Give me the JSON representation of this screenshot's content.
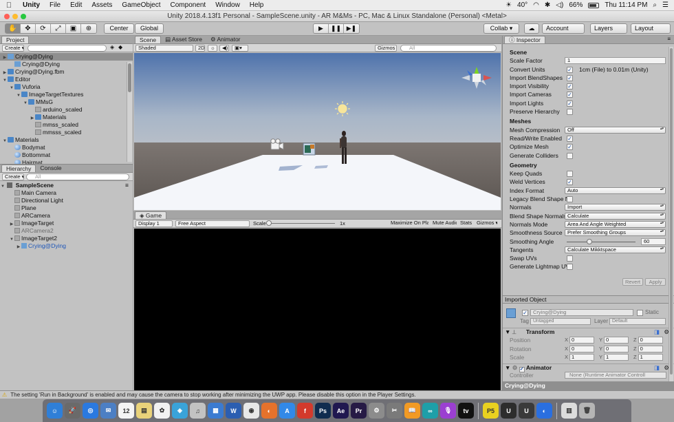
{
  "menubar": {
    "items": [
      "Unity",
      "File",
      "Edit",
      "Assets",
      "GameObject",
      "Component",
      "Window",
      "Help"
    ],
    "weather": "40°",
    "battery": "66%",
    "battery_fill": 0.66,
    "clock": "Thu 11:14 PM"
  },
  "window": {
    "title": "Unity 2018.4.13f1 Personal - SampleScene.unity - AR M&Ms - PC, Mac & Linux Standalone (Personal) <Metal>"
  },
  "toolbar": {
    "tools": [
      "✋",
      "✥",
      "⟳",
      "⤢",
      "▣",
      "⊕"
    ],
    "center": "Center",
    "global": "Global",
    "play": [
      "▶",
      "❚❚",
      "▶❚"
    ],
    "collab": "Collab ▾",
    "cloud": "☁",
    "account": "Account",
    "layers": "Layers",
    "layout": "Layout"
  },
  "project": {
    "tab": "Project",
    "create": "Create ▾",
    "items": [
      {
        "label": "Crying@Dying",
        "indent": 0,
        "arrow": "▶",
        "icon": "cube",
        "sel": true
      },
      {
        "label": "Crying@Dying",
        "indent": 1,
        "arrow": "",
        "icon": "cube"
      },
      {
        "label": "Crying@Dying.fbm",
        "indent": 0,
        "arrow": "▶",
        "icon": "fold"
      },
      {
        "label": "Editor",
        "indent": 0,
        "arrow": "▼",
        "icon": "fold"
      },
      {
        "label": "Vuforia",
        "indent": 1,
        "arrow": "▼",
        "icon": "fold"
      },
      {
        "label": "ImageTargetTextures",
        "indent": 2,
        "arrow": "▼",
        "icon": "fold"
      },
      {
        "label": "MMsG",
        "indent": 3,
        "arrow": "▼",
        "icon": "fold"
      },
      {
        "label": "arduino_scaled",
        "indent": 4,
        "arrow": "",
        "icon": "go"
      },
      {
        "label": "Materials",
        "indent": 4,
        "arrow": "▶",
        "icon": "fold"
      },
      {
        "label": "mmss_scaled",
        "indent": 4,
        "arrow": "",
        "icon": "go"
      },
      {
        "label": "mmsss_scaled",
        "indent": 4,
        "arrow": "",
        "icon": "go"
      },
      {
        "label": "Materials",
        "indent": 0,
        "arrow": "▼",
        "icon": "fold"
      },
      {
        "label": "Bodymat",
        "indent": 1,
        "arrow": "",
        "icon": "ball"
      },
      {
        "label": "Bottommat",
        "indent": 1,
        "arrow": "",
        "icon": "ball"
      },
      {
        "label": "Hairmat",
        "indent": 1,
        "arrow": "",
        "icon": "ball"
      }
    ]
  },
  "hierarchy": {
    "tabs": [
      "Hierarchy",
      "Console"
    ],
    "create": "Create ▾",
    "search": "All",
    "scene": "SampleScene",
    "items": [
      {
        "label": "Main Camera",
        "indent": 1,
        "arrow": "",
        "style": ""
      },
      {
        "label": "Directional Light",
        "indent": 1,
        "arrow": "",
        "style": ""
      },
      {
        "label": "Plane",
        "indent": 1,
        "arrow": "",
        "style": ""
      },
      {
        "label": "ARCamera",
        "indent": 1,
        "arrow": "",
        "style": ""
      },
      {
        "label": "ImageTarget",
        "indent": 1,
        "arrow": "▶",
        "style": ""
      },
      {
        "label": "ARCamera2",
        "indent": 1,
        "arrow": "",
        "style": "gray"
      },
      {
        "label": "ImageTarget2",
        "indent": 1,
        "arrow": "▼",
        "style": ""
      },
      {
        "label": "Crying@Dying",
        "indent": 2,
        "arrow": "▶",
        "style": "blue"
      }
    ]
  },
  "scene": {
    "tabs": [
      "Scene",
      "Asset Store",
      "Animator"
    ],
    "shaded": "Shaded",
    "twod": "2D",
    "gizmos": "Gizmos ▾",
    "search": "All"
  },
  "game": {
    "tab": "Game",
    "display": "Display 1",
    "aspect": "Free Aspect",
    "scale_label": "Scale",
    "scale_value": "1x",
    "buttons": [
      "Maximize On Play",
      "Mute Audio",
      "Stats",
      "Gizmos ▾"
    ]
  },
  "inspector": {
    "tab": "Inspector",
    "rows": [
      {
        "type": "sec",
        "label": "Scene"
      },
      {
        "type": "field",
        "label": "Scale Factor",
        "value": "1"
      },
      {
        "type": "chktext",
        "label": "Convert Units",
        "checked": true,
        "text": "1cm (File) to 0.01m (Unity)"
      },
      {
        "type": "chk",
        "label": "Import BlendShapes",
        "checked": true
      },
      {
        "type": "chk",
        "label": "Import Visibility",
        "checked": true
      },
      {
        "type": "chk",
        "label": "Import Cameras",
        "checked": true
      },
      {
        "type": "chk",
        "label": "Import Lights",
        "checked": true
      },
      {
        "type": "chk",
        "label": "Preserve Hierarchy",
        "checked": false
      },
      {
        "type": "sec",
        "label": "Meshes"
      },
      {
        "type": "drop",
        "label": "Mesh Compression",
        "value": "Off"
      },
      {
        "type": "chk",
        "label": "Read/Write Enabled",
        "checked": true
      },
      {
        "type": "chk",
        "label": "Optimize Mesh",
        "checked": true
      },
      {
        "type": "chk",
        "label": "Generate Colliders",
        "checked": false
      },
      {
        "type": "sec",
        "label": "Geometry"
      },
      {
        "type": "chk",
        "label": "Keep Quads",
        "checked": false
      },
      {
        "type": "chk",
        "label": "Weld Vertices",
        "checked": true
      },
      {
        "type": "drop",
        "label": "Index Format",
        "value": "Auto"
      },
      {
        "type": "chk",
        "label": "Legacy Blend Shape N",
        "checked": false
      },
      {
        "type": "drop",
        "label": "Normals",
        "value": "Import"
      },
      {
        "type": "drop",
        "label": "Blend Shape Normals",
        "value": "Calculate"
      },
      {
        "type": "drop",
        "label": "Normals Mode",
        "value": "Area And Angle Weighted"
      },
      {
        "type": "drop",
        "label": "Smoothness Source",
        "value": "Prefer Smoothing Groups"
      },
      {
        "type": "slider",
        "label": "Smoothing Angle",
        "value": "60",
        "fill": 0.33
      },
      {
        "type": "drop",
        "label": "Tangents",
        "value": "Calculate Mikktspace"
      },
      {
        "type": "chk",
        "label": "Swap UVs",
        "checked": false
      },
      {
        "type": "chk",
        "label": "Generate Lightmap UV",
        "checked": false
      }
    ],
    "revert": "Revert",
    "apply": "Apply",
    "imported_object": "Imported Object",
    "object_name": "Crying@Dying",
    "static": "Static",
    "tag_label": "Tag",
    "tag_value": "Untagged",
    "layer_label": "Layer",
    "layer_value": "Default",
    "transform": "Transform",
    "position": {
      "label": "Position",
      "x": "0",
      "y": "0",
      "z": "0"
    },
    "rotation": {
      "label": "Rotation",
      "x": "0",
      "y": "0",
      "z": "0"
    },
    "scale": {
      "label": "Scale",
      "x": "1",
      "y": "1",
      "z": "1"
    },
    "animator": "Animator",
    "controller_label": "Controller",
    "controller_value": "None (Runtime Animator Controll",
    "footer": "Crying@Dying"
  },
  "status": {
    "message": "The setting 'Run in Background' is enabled and may cause the camera to stop working after minimizing the UWP app. Please disable this option in the Player Settings."
  },
  "dock": {
    "apps": [
      {
        "label": "☺",
        "color": "#2f7fd8"
      },
      {
        "label": "🚀",
        "color": "#6a6a6a"
      },
      {
        "label": "◎",
        "color": "#2a79e0"
      },
      {
        "label": "✉",
        "color": "#4c7fc4"
      },
      {
        "label": "12",
        "color": "#f4f4f4"
      },
      {
        "label": "▤",
        "color": "#e9d27a"
      },
      {
        "label": "✿",
        "color": "#f1f1f1"
      },
      {
        "label": "◈",
        "color": "#3aa3d9"
      },
      {
        "label": "♫",
        "color": "#c2c2c2"
      },
      {
        "label": "▦",
        "color": "#3b7bd1"
      },
      {
        "label": "W",
        "color": "#2b5eb1"
      },
      {
        "label": "◉",
        "color": "#e8e8e8"
      },
      {
        "label": "◐",
        "color": "#e5722b"
      },
      {
        "label": "A",
        "color": "#3289e8"
      },
      {
        "label": "f",
        "color": "#d33a2c"
      },
      {
        "label": "Ps",
        "color": "#102c4f"
      },
      {
        "label": "Ae",
        "color": "#201850"
      },
      {
        "label": "Pr",
        "color": "#261a45"
      },
      {
        "label": "⚙",
        "color": "#8c8c8c"
      },
      {
        "label": "✂",
        "color": "#7a7a7a"
      },
      {
        "label": "📖",
        "color": "#f19a24"
      },
      {
        "label": "∞",
        "color": "#1e9fa8"
      },
      {
        "label": "🎙",
        "color": "#9b3fd1"
      },
      {
        "label": "tv",
        "color": "#111111"
      },
      {
        "label": "P5",
        "color": "#e9d120"
      },
      {
        "label": "U",
        "color": "#2d2d2d"
      },
      {
        "label": "U",
        "color": "#3a3a3a"
      },
      {
        "label": "◐",
        "color": "#2a6fe0"
      },
      {
        "label": "▥",
        "color": "#dcdcdc"
      },
      {
        "label": "🗑",
        "color": "#b5b5b5"
      }
    ]
  },
  "colors": {
    "selection": "#8f8f8f",
    "sky": "#5b7fb6",
    "ground": "#6c6561",
    "plane": "#f4f6fa"
  }
}
